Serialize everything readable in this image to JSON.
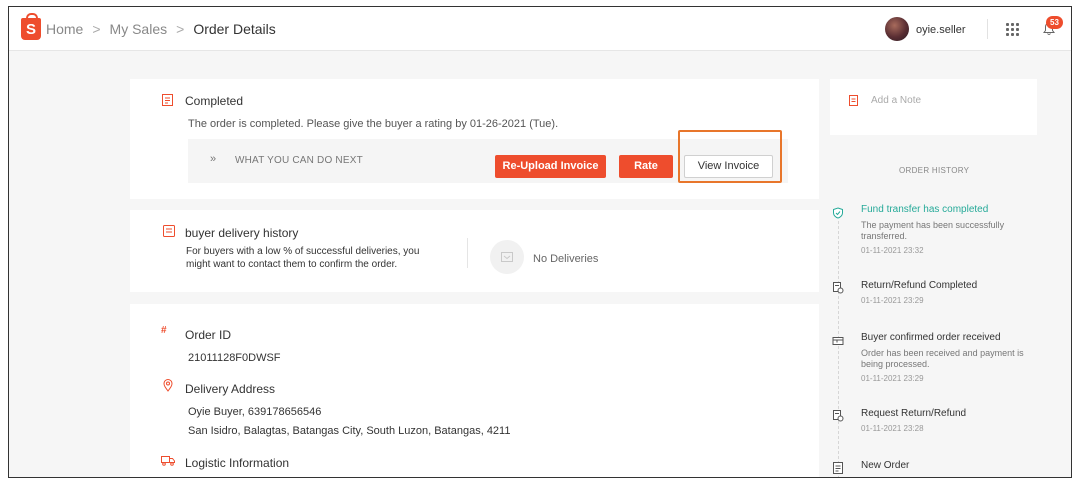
{
  "breadcrumb": {
    "home": "Home",
    "sales": "My Sales",
    "current": "Order Details",
    "separator": ">"
  },
  "header": {
    "username": "oyie.seller",
    "notification_count": "53"
  },
  "status_card": {
    "title": "Completed",
    "message": "The order is completed. Please give the buyer a rating by 01-26-2021 (Tue).",
    "next_label": "WHAT YOU CAN DO NEXT",
    "next_chevron": "»",
    "reupload_label": "Re-Upload Invoice",
    "rate_label": "Rate",
    "view_invoice_label": "View Invoice"
  },
  "delivery_history": {
    "title": "buyer delivery history",
    "description_line1": "For buyers with a low % of successful deliveries, you",
    "description_line2": "might want to contact them to confirm the order.",
    "no_deliveries": "No Deliveries"
  },
  "order_info": {
    "order_id_label": "Order ID",
    "order_id": "21011128F0DWSF",
    "address_label": "Delivery Address",
    "address_name": "Oyie Buyer, 639178656546",
    "address_line": "San Isidro, Balagtas, Batangas City, South Luzon, Batangas, 4211",
    "logistic_label": "Logistic Information"
  },
  "note": {
    "placeholder": "Add a Note"
  },
  "order_history": {
    "heading": "ORDER HISTORY",
    "events": [
      {
        "title": "Fund transfer has completed",
        "desc_line1": "The payment has been successfully",
        "desc_line2": "transferred.",
        "time": "01-11-2021 23:32"
      },
      {
        "title": "Return/Refund Completed",
        "time": "01-11-2021 23:29"
      },
      {
        "title": "Buyer confirmed order received",
        "desc_line1": "Order has been received and payment is",
        "desc_line2": "being processed.",
        "time": "01-11-2021 23:29"
      },
      {
        "title": "Request Return/Refund",
        "time": "01-11-2021 23:28"
      },
      {
        "title": "New Order"
      }
    ]
  },
  "colors": {
    "brand": "#ee4d2d",
    "success": "#26aa99",
    "highlight": "#e8762b"
  }
}
